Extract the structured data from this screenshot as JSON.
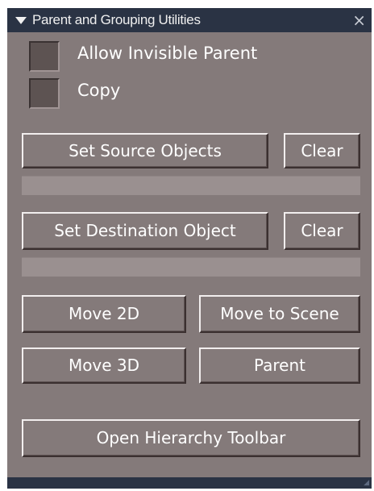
{
  "panel": {
    "title": "Parent and Grouping Utilities",
    "close_glyph": "×",
    "collapse_icon": "triangle-down-icon",
    "close_icon": "close-icon"
  },
  "options": {
    "allow_invisible_parent": {
      "label": "Allow Invisible Parent",
      "checked": false
    },
    "copy": {
      "label": "Copy",
      "checked": false
    }
  },
  "source": {
    "set_label": "Set Source Objects",
    "clear_label": "Clear",
    "field_value": ""
  },
  "destination": {
    "set_label": "Set Destination Object",
    "clear_label": "Clear",
    "field_value": ""
  },
  "actions": {
    "move_2d": "Move 2D",
    "move_to_scene": "Move to Scene",
    "move_3d": "Move 3D",
    "parent": "Parent",
    "open_hierarchy_toolbar": "Open Hierarchy Toolbar"
  },
  "colors": {
    "panel_bg": "#847a7a",
    "titlebar_bg": "#2a3344",
    "field_bg": "#9a9090",
    "checkbox_bg": "#5d5352"
  }
}
